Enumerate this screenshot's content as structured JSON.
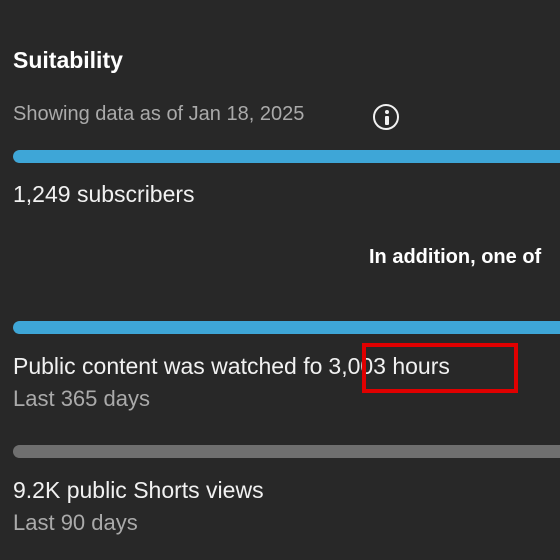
{
  "section": {
    "title": "Suitability",
    "as_of": "Showing data as of Jan 18, 2025",
    "info_icon": "info-icon"
  },
  "metrics": {
    "subscribers": {
      "text": "1,249 subscribers",
      "progress": 1.0,
      "bar_color": "#3ea6d7"
    },
    "addition_note": "In addition, one of",
    "watch_hours": {
      "prefix": "Public content was watched fo",
      "value": "3,003 hours",
      "period": "Last 365 days",
      "progress": 1.0,
      "bar_color": "#3ea6d7",
      "highlight_color": "#e00000"
    },
    "shorts_views": {
      "text": "9.2K public Shorts views",
      "period": "Last 90 days",
      "progress": 1.0,
      "bar_color": "#6f6f6f"
    }
  }
}
